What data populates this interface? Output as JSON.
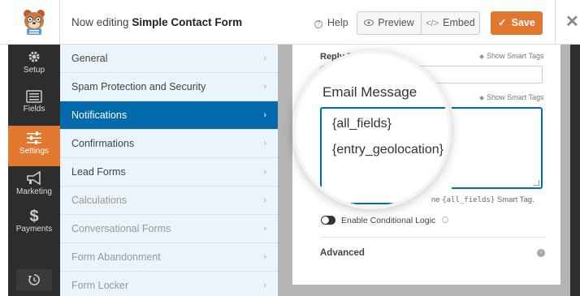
{
  "header": {
    "editing_prefix": "Now editing",
    "form_name": "Simple Contact Form",
    "help_label": "Help",
    "preview_label": "Preview",
    "embed_label": "Embed",
    "save_label": "Save"
  },
  "leftbar": {
    "items": [
      {
        "label": "Setup",
        "icon": "gear-icon"
      },
      {
        "label": "Fields",
        "icon": "fields-list-icon"
      },
      {
        "label": "Settings",
        "icon": "sliders-icon"
      },
      {
        "label": "Marketing",
        "icon": "megaphone-icon"
      },
      {
        "label": "Payments",
        "icon": "dollar-icon"
      }
    ],
    "active": "Settings"
  },
  "settings_nav": {
    "items": [
      {
        "label": "General"
      },
      {
        "label": "Spam Protection and Security"
      },
      {
        "label": "Notifications"
      },
      {
        "label": "Confirmations"
      },
      {
        "label": "Lead Forms"
      },
      {
        "label": "Calculations"
      },
      {
        "label": "Conversational Forms"
      },
      {
        "label": "Form Abandonment"
      },
      {
        "label": "Form Locker"
      }
    ],
    "active": "Notifications"
  },
  "notification": {
    "reply_to_label": "Reply-To",
    "show_smart_tags": "Show Smart Tags",
    "email_message_label": "Email Message",
    "message_line1": "{all_fields}",
    "message_line2": "{entry_geolocation}",
    "hint_prefix": "ne",
    "hint_code": "{all_fields}",
    "hint_suffix": "Smart Tag.",
    "conditional_logic_label": "Enable Conditional Logic",
    "advanced_label": "Advanced"
  },
  "colors": {
    "accent_orange": "#e27730",
    "active_blue": "#036aab",
    "dark_sidebar": "#2d2d2d",
    "nav_bg": "#ebf3fb"
  }
}
